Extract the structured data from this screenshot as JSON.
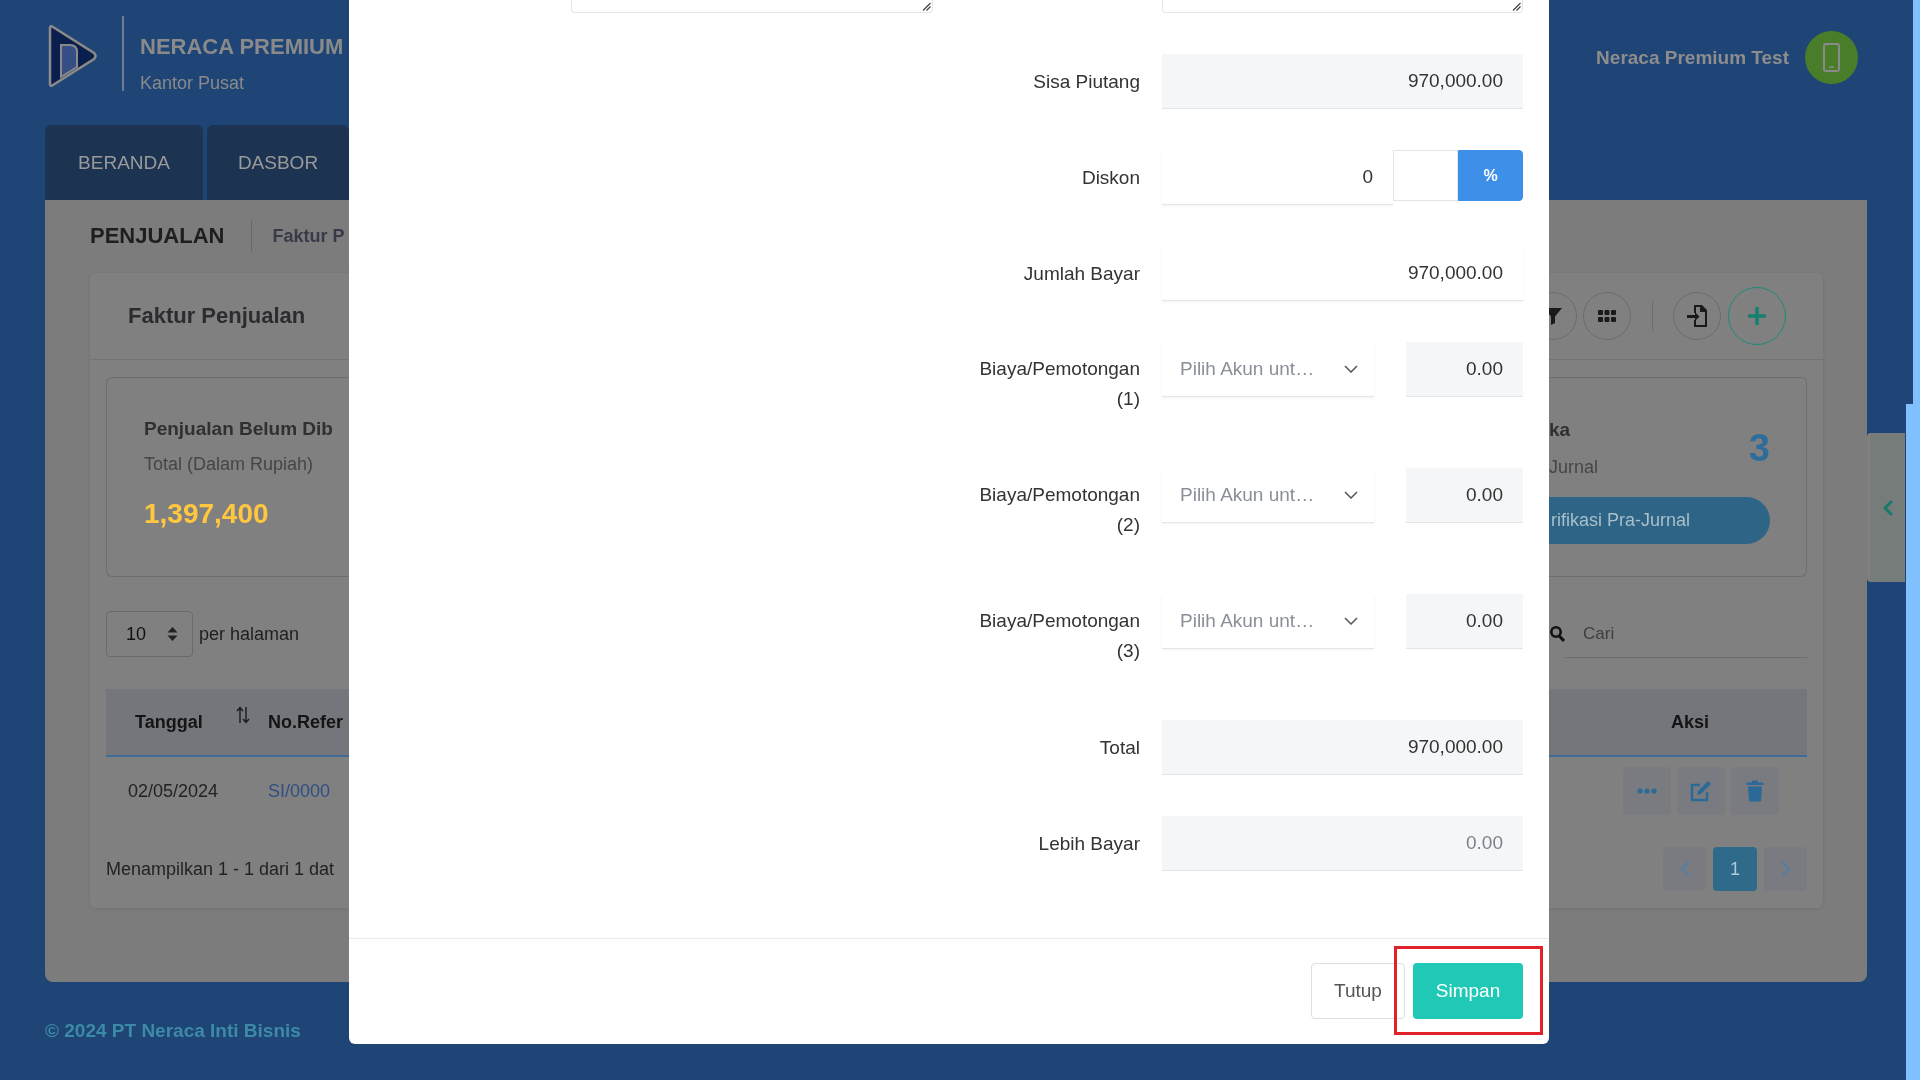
{
  "header": {
    "brand": "NERACA PREMIUM",
    "branch": "Kantor Pusat",
    "user_name": "Neraca Premium Test"
  },
  "nav_tabs": [
    {
      "label": "BERANDA",
      "selected": false
    },
    {
      "label": "DASBOR",
      "selected": false
    }
  ],
  "breadcrumb": [
    "PENJUALAN",
    "Faktur P"
  ],
  "card": {
    "title": "Faktur Penjualan"
  },
  "summary_cards": [
    {
      "kind": "amount",
      "title": "Penjualan Belum Dib",
      "subtitle": "Total (Dalam Rupiah)",
      "value": "1,397,400"
    },
    {
      "kind": "count",
      "title": "ka",
      "subtitle": "Jurnal",
      "count": "3",
      "action": "rifikasi Pra-Jurnal"
    }
  ],
  "per_page": {
    "value": "10",
    "label": "per halaman"
  },
  "search": {
    "placeholder": "Cari"
  },
  "table": {
    "columns": [
      {
        "label": "Tanggal",
        "sortable": true
      },
      {
        "label": "No.Refer",
        "sortable": false
      },
      {
        "label": "Aksi",
        "sortable": false
      }
    ],
    "rows": [
      {
        "date": "02/05/2024",
        "reference": "SI/0000"
      }
    ]
  },
  "pagination": {
    "summary": "Menampilkan 1 - 1 dari 1 dat",
    "pages": [
      {
        "label": "1",
        "selected": true
      }
    ]
  },
  "footer": {
    "copyright": "© 2024 PT Neraca Inti Bisnis"
  },
  "modal": {
    "fields": [
      {
        "kind": "readonly",
        "label": "Sisa Piutang",
        "value": "970,000.00"
      },
      {
        "kind": "discount",
        "label": "Diskon",
        "value": "0",
        "units": [
          {
            "selected": false
          },
          {
            "label": "%",
            "selected": true
          }
        ]
      },
      {
        "kind": "input",
        "label": "Jumlah Bayar",
        "value": "970,000.00"
      },
      {
        "kind": "charge",
        "label": "Biaya/Pemotongan (1)",
        "account_placeholder": "Pilih Akun unt…",
        "amount": "0.00"
      },
      {
        "kind": "charge",
        "label": "Biaya/Pemotongan (2)",
        "account_placeholder": "Pilih Akun unt…",
        "amount": "0.00"
      },
      {
        "kind": "charge",
        "label": "Biaya/Pemotongan (3)",
        "account_placeholder": "Pilih Akun unt…",
        "amount": "0.00"
      },
      {
        "kind": "readonly",
        "label": "Total",
        "value": "970,000.00"
      },
      {
        "kind": "readonly",
        "label": "Lebih Bayar",
        "placeholder": "0.00"
      }
    ],
    "buttons": [
      {
        "label": "Tutup",
        "kind": "secondary",
        "highlighted": false
      },
      {
        "label": "Simpan",
        "kind": "primary",
        "highlighted": true
      }
    ]
  }
}
